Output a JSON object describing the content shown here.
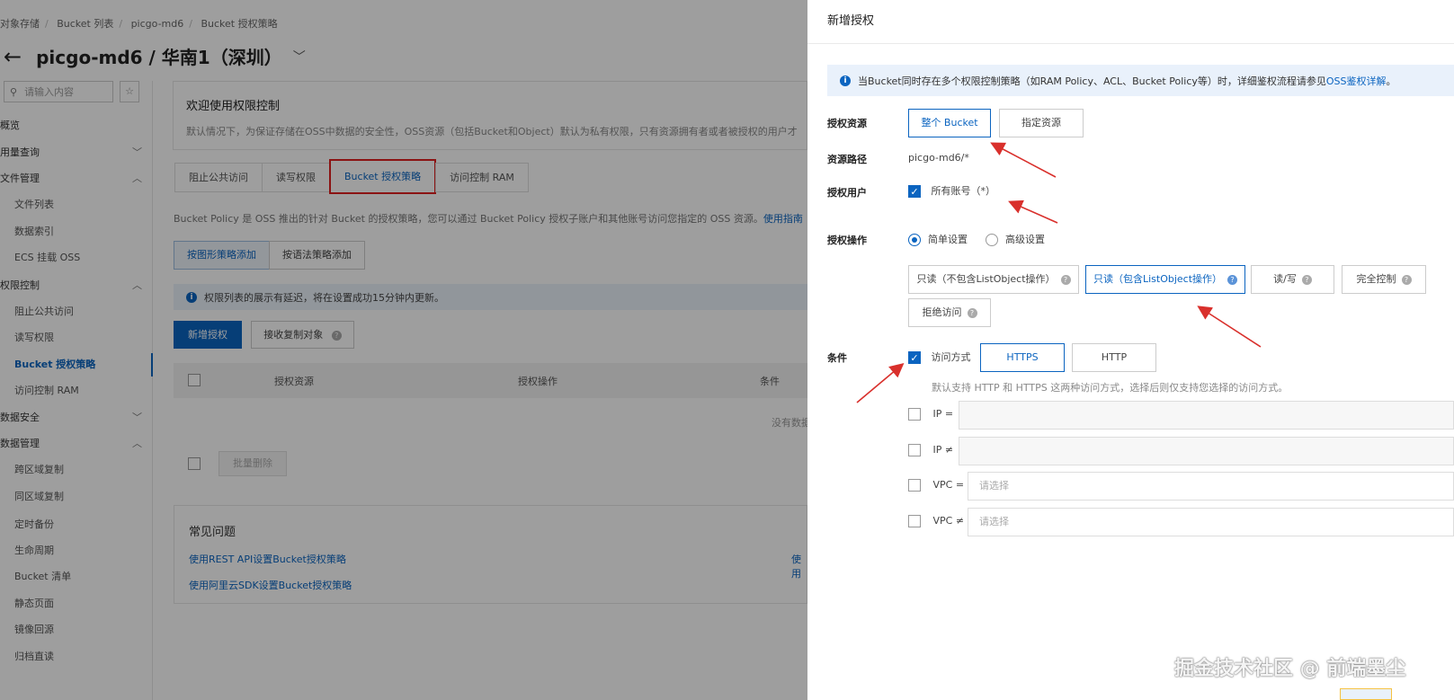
{
  "breadcrumb": [
    "对象存储",
    "Bucket 列表",
    "picgo-md6",
    "Bucket 授权策略"
  ],
  "page": {
    "back_icon": "arrow-left-icon",
    "title": "picgo-md6 / 华南1（深圳）"
  },
  "sidebar": {
    "search_placeholder": "请输入内容",
    "items": [
      {
        "label": "概览",
        "chevron": ""
      },
      {
        "label": "用量查询",
        "chevron": "﹀"
      },
      {
        "label": "文件管理",
        "chevron": "︿"
      },
      {
        "label": "文件列表",
        "chevron": ""
      },
      {
        "label": "数据索引",
        "chevron": ""
      },
      {
        "label": "ECS 挂载 OSS",
        "chevron": ""
      },
      {
        "label": "权限控制",
        "chevron": "︿"
      },
      {
        "label": "阻止公共访问",
        "chevron": ""
      },
      {
        "label": "读写权限",
        "chevron": ""
      },
      {
        "label": "Bucket 授权策略",
        "chevron": ""
      },
      {
        "label": "访问控制 RAM",
        "chevron": ""
      },
      {
        "label": "数据安全",
        "chevron": "﹀"
      },
      {
        "label": "数据管理",
        "chevron": "︿"
      },
      {
        "label": "跨区域复制",
        "chevron": ""
      },
      {
        "label": "同区域复制",
        "chevron": ""
      },
      {
        "label": "定时备份",
        "chevron": ""
      },
      {
        "label": "生命周期",
        "chevron": ""
      },
      {
        "label": "Bucket 清单",
        "chevron": ""
      },
      {
        "label": "静态页面",
        "chevron": ""
      },
      {
        "label": "镜像回源",
        "chevron": ""
      },
      {
        "label": "归档直读",
        "chevron": ""
      }
    ]
  },
  "welcome": {
    "title": "欢迎使用权限控制",
    "desc": "默认情况下，为保证存储在OSS中数据的安全性，OSS资源（包括Bucket和Object）默认为私有权限，只有资源拥有者或者被授权的用户才"
  },
  "tabs": [
    "阻止公共访问",
    "读写权限",
    "Bucket 授权策略",
    "访问控制 RAM"
  ],
  "policy_desc": {
    "text": "Bucket Policy 是 OSS 推出的针对 Bucket 的授权策略，您可以通过 Bucket Policy 授权子账户和其他账号访问您指定的 OSS 资源。",
    "link": "使用指南"
  },
  "add_mode": [
    "按图形策略添加",
    "按语法策略添加"
  ],
  "left_notice": "权限列表的展示有延迟，将在设置成功15分钟内更新。",
  "buttons": {
    "add": "新增授权",
    "receive": "接收复制对象",
    "batch_delete": "批量删除"
  },
  "table": {
    "headers": [
      "授权资源",
      "授权操作",
      "条件"
    ],
    "empty": "没有数据"
  },
  "faq": {
    "title": "常见问题",
    "links": [
      "使用REST API设置Bucket授权策略",
      "使用阿里云SDK设置Bucket授权策略"
    ],
    "extra": "使用"
  },
  "drawer": {
    "title": "新增授权",
    "notice": {
      "text": "当Bucket同时存在多个权限控制策略（如RAM Policy、ACL、Bucket Policy等）时，详细鉴权流程请参见",
      "link": "OSS鉴权详解",
      "tail": "。"
    },
    "resource": {
      "label": "授权资源",
      "options": [
        "整个 Bucket",
        "指定资源"
      ],
      "selected": "整个 Bucket"
    },
    "path": {
      "label": "资源路径",
      "value": "picgo-md6/*"
    },
    "user": {
      "label": "授权用户",
      "checkbox": "所有账号（*）",
      "checked": true
    },
    "operation": {
      "label": "授权操作",
      "modes": [
        "简单设置",
        "高级设置"
      ],
      "selected_mode": "简单设置",
      "options": [
        "只读（不包含ListObject操作）",
        "只读（包含ListObject操作）",
        "读/写",
        "完全控制",
        "拒绝访问"
      ],
      "selected": "只读（包含ListObject操作）"
    },
    "condition": {
      "label": "条件",
      "access_label": "访问方式",
      "access_checked": true,
      "protocols": [
        "HTTPS",
        "HTTP"
      ],
      "selected_protocol": "HTTPS",
      "hint": "默认支持 HTTP 和 HTTPS 这两种访问方式，选择后则仅支持您选择的访问方式。",
      "ip_eq": "IP =",
      "ip_ne": "IP ≠",
      "vpc_eq": "VPC =",
      "vpc_ne": "VPC ≠",
      "select_placeholder": "请选择"
    }
  },
  "watermark": "掘金技术社区 @ 前端墨尘",
  "colors": {
    "primary": "#0b64c0",
    "highlight": "#e02020",
    "annotation_arrow": "#d9302c"
  }
}
